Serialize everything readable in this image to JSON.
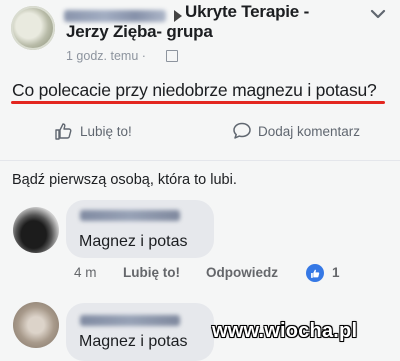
{
  "post": {
    "group_line1": "Ukryte Terapie -",
    "group_line2": "Jerzy Zięba- grupa",
    "time": "1 godz. temu ·",
    "text": "Co polecacie przy niedobrze magnezu i potasu?"
  },
  "actions": {
    "like_label": "Lubię to!",
    "comment_label": "Dodaj komentarz"
  },
  "first_like_text": "Bądź pierwszą osobą, która to lubi.",
  "comments": [
    {
      "text": "Magnez i potas",
      "time": "4 m",
      "like_label": "Lubię to!",
      "reply_label": "Odpowiedz",
      "like_count": "1"
    },
    {
      "text": "Magnez i potas"
    }
  ],
  "watermark": "www.wiocha.pl",
  "icons": {
    "post_avatar": "avatar",
    "menu": "chevron-down-icon",
    "like": "thumbs-up-icon",
    "comment": "speech-bubble-icon",
    "visibility": "globe-icon"
  },
  "colors": {
    "underline": "#e3261f",
    "like_badge": "#3578e5"
  }
}
